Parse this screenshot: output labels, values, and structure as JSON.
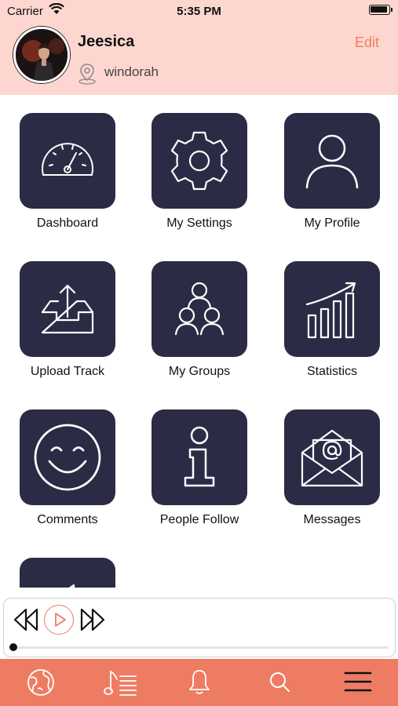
{
  "status_bar": {
    "carrier": "Carrier",
    "time": "5:35 PM"
  },
  "profile": {
    "name": "Jeesica",
    "location": "windorah",
    "edit_label": "Edit"
  },
  "menu": {
    "items": [
      {
        "label": "Dashboard",
        "icon": "speedometer-icon"
      },
      {
        "label": "My Settings",
        "icon": "gear-icon"
      },
      {
        "label": "My Profile",
        "icon": "user-icon"
      },
      {
        "label": "Upload Track",
        "icon": "upload-tray-icon"
      },
      {
        "label": "My Groups",
        "icon": "group-icon"
      },
      {
        "label": "Statistics",
        "icon": "growth-chart-icon"
      },
      {
        "label": "Comments",
        "icon": "smiley-icon"
      },
      {
        "label": "People Follow",
        "icon": "info-icon"
      },
      {
        "label": "Messages",
        "icon": "email-envelope-icon"
      },
      {
        "label": "",
        "icon": "speaker-icon"
      }
    ]
  },
  "player": {
    "progress": 0.0,
    "accent": "#ee7c62"
  },
  "tabbar": {
    "color": "#ee7c62",
    "tabs": [
      "globe-icon",
      "music-playlist-icon",
      "bell-icon",
      "search-icon",
      "menu-icon"
    ]
  },
  "colors": {
    "header_bg": "#fdd7cf",
    "tile_bg": "#2b2b45",
    "accent": "#ee7c62"
  }
}
